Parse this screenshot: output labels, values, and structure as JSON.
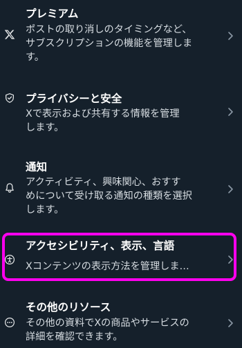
{
  "settings": {
    "items": [
      {
        "icon": "x-logo-icon",
        "title": "プレミアム",
        "description": "ポストの取り消しのタイミングなど、\nサブスクリプションの機能を管理しま\nす。"
      },
      {
        "icon": "shield-icon",
        "title": "プライバシーと安全",
        "description": "Xで表示および共有する情報を管理\nします。"
      },
      {
        "icon": "bell-icon",
        "title": "通知",
        "description": "アクティビティ、興味関心、おすす\nめについて受け取る通知の種類を選択\nします。"
      },
      {
        "icon": "accessibility-icon",
        "title": "アクセシビリティ、表示、言語",
        "description": "Xコンテンツの表示方法を管理しま…"
      },
      {
        "icon": "more-circle-icon",
        "title": "その他のリソース",
        "description": "その他の資料でXの商品やサービスの\n詳細を確認できます。"
      }
    ],
    "chevron_icon": "chevron-right-icon",
    "highlight_color": "#ff00ee",
    "background_color": "#15202b"
  }
}
